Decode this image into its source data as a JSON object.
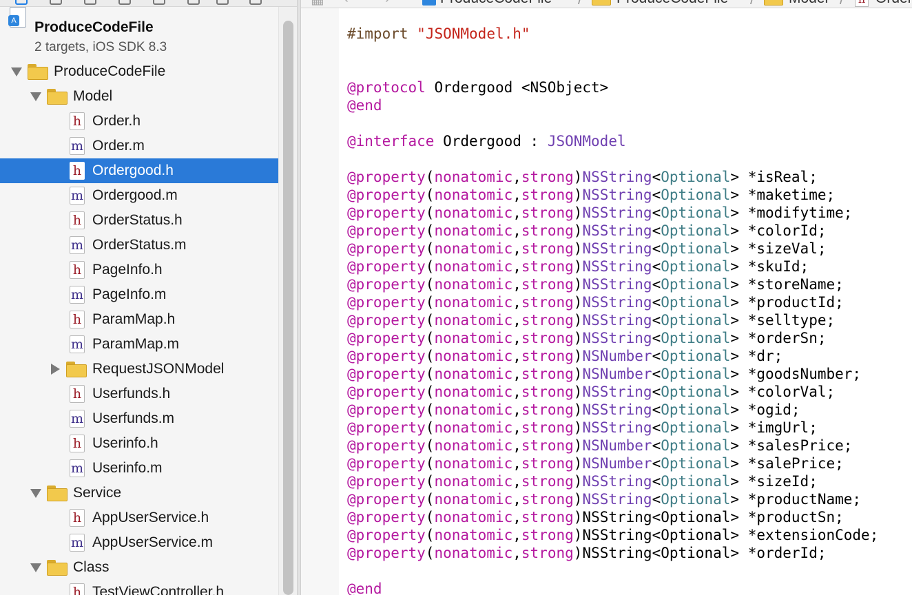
{
  "colors": {
    "keyword": "#b4189f",
    "string": "#c4241a",
    "class_name": "#6f3fb0",
    "protocol_name": "#3f7d86",
    "selection": "#2a7ad8"
  },
  "jump_bar": {
    "items": [
      "ProduceCodeFile",
      "ProduceCodeFile",
      "Model",
      "Ordergood.h"
    ]
  },
  "navigator": {
    "project": {
      "name": "ProduceCodeFile",
      "subtitle": "2 targets, iOS SDK 8.3"
    },
    "items": [
      {
        "label": "ProduceCodeFile",
        "kind": "folder",
        "expanded": true
      },
      {
        "label": "Model",
        "kind": "folder",
        "expanded": true
      },
      {
        "label": "Order.h",
        "kind": "file",
        "icon": "h"
      },
      {
        "label": "Order.m",
        "kind": "file",
        "icon": "m"
      },
      {
        "label": "Ordergood.h",
        "kind": "file",
        "icon": "h",
        "selected": true
      },
      {
        "label": "Ordergood.m",
        "kind": "file",
        "icon": "m"
      },
      {
        "label": "OrderStatus.h",
        "kind": "file",
        "icon": "h"
      },
      {
        "label": "OrderStatus.m",
        "kind": "file",
        "icon": "m"
      },
      {
        "label": "PageInfo.h",
        "kind": "file",
        "icon": "h"
      },
      {
        "label": "PageInfo.m",
        "kind": "file",
        "icon": "m"
      },
      {
        "label": "ParamMap.h",
        "kind": "file",
        "icon": "h"
      },
      {
        "label": "ParamMap.m",
        "kind": "file",
        "icon": "m"
      },
      {
        "label": "RequestJSONModel",
        "kind": "folder",
        "expanded": false
      },
      {
        "label": "Userfunds.h",
        "kind": "file",
        "icon": "h"
      },
      {
        "label": "Userfunds.m",
        "kind": "file",
        "icon": "m"
      },
      {
        "label": "Userinfo.h",
        "kind": "file",
        "icon": "h"
      },
      {
        "label": "Userinfo.m",
        "kind": "file",
        "icon": "m"
      },
      {
        "label": "Service",
        "kind": "folder",
        "expanded": true
      },
      {
        "label": "AppUserService.h",
        "kind": "file",
        "icon": "h"
      },
      {
        "label": "AppUserService.m",
        "kind": "file",
        "icon": "m"
      },
      {
        "label": "Class",
        "kind": "folder",
        "expanded": true
      },
      {
        "label": "TestViewController.h",
        "kind": "file",
        "icon": "h"
      }
    ]
  },
  "editor": {
    "import_directive": "#import",
    "import_file": "\"JSONModel.h\"",
    "protocol_keyword": "@protocol",
    "protocol_decl": " Ordergood <NSObject>",
    "end_keyword": "@end",
    "interface_keyword": "@interface",
    "interface_name": " Ordergood : ",
    "superclass": "JSONModel",
    "property_keyword": "@property",
    "attr_nonatomic": "nonatomic",
    "attr_strong": "strong",
    "optional_protocol": "Optional",
    "properties": [
      {
        "type": "NSString",
        "name": "*isReal;"
      },
      {
        "type": "NSString",
        "name": "*maketime;"
      },
      {
        "type": "NSString",
        "name": "*modifytime;"
      },
      {
        "type": "NSString",
        "name": "*colorId;"
      },
      {
        "type": "NSString",
        "name": "*sizeVal;"
      },
      {
        "type": "NSString",
        "name": "*skuId;"
      },
      {
        "type": "NSString",
        "name": "*storeName;"
      },
      {
        "type": "NSString",
        "name": "*productId;"
      },
      {
        "type": "NSString",
        "name": "*selltype;"
      },
      {
        "type": "NSString",
        "name": "*orderSn;"
      },
      {
        "type": "NSNumber",
        "name": "*dr;"
      },
      {
        "type": "NSNumber",
        "name": "*goodsNumber;"
      },
      {
        "type": "NSString",
        "name": "*colorVal;"
      },
      {
        "type": "NSString",
        "name": "*ogid;"
      },
      {
        "type": "NSString",
        "name": "*imgUrl;"
      },
      {
        "type": "NSNumber",
        "name": "*salesPrice;"
      },
      {
        "type": "NSNumber",
        "name": "*salePrice;"
      },
      {
        "type": "NSString",
        "name": "*sizeId;"
      },
      {
        "type": "NSString",
        "name": "*productName;"
      },
      {
        "type": "NSString",
        "name": "*productSn;",
        "highlighted": false
      },
      {
        "type": "NSString",
        "name": "*extensionCode;",
        "highlighted": false
      },
      {
        "type": "NSString",
        "name": "*orderId;",
        "highlighted": false
      }
    ]
  }
}
